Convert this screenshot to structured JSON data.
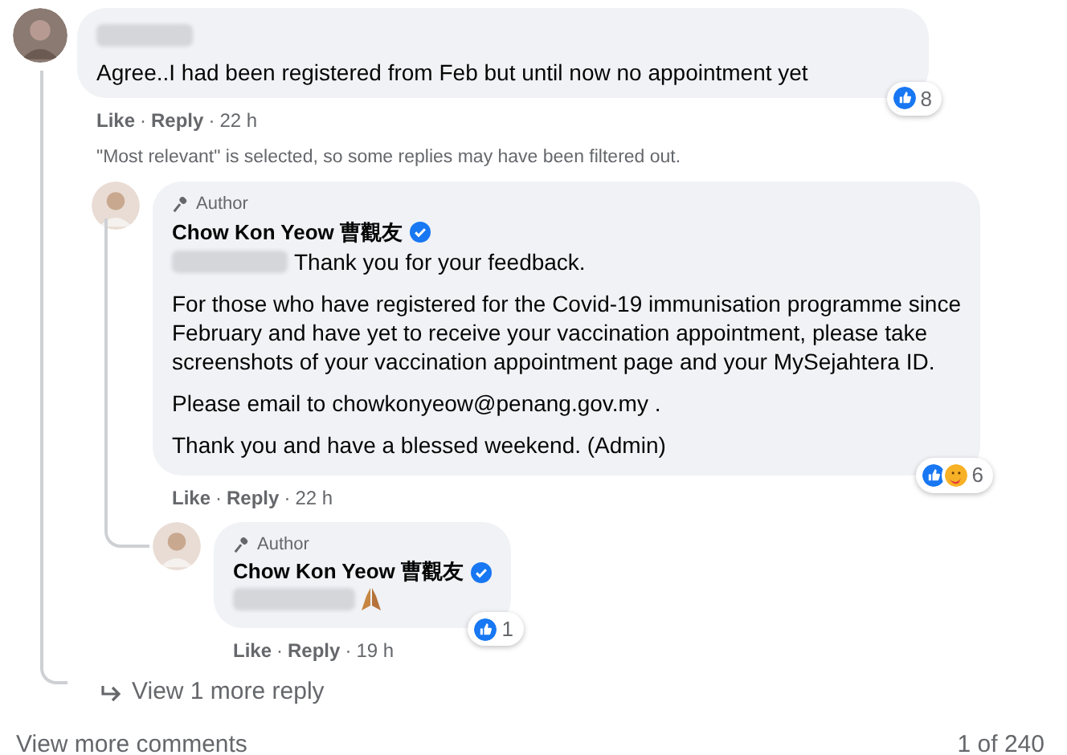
{
  "comment": {
    "body": [
      "Agree..I had been registered from Feb but until now no appointment yet"
    ],
    "reactions": [
      {
        "kind": "like"
      }
    ],
    "reaction_count": "8",
    "actions": [
      "Like",
      "Reply"
    ],
    "separator": "·",
    "time": "22 h"
  },
  "filter_note": "\"Most relevant\" is selected, so some replies may have been filtered out.",
  "replies": [
    {
      "badge": "Author",
      "name": "Chow Kon Yeow 曹觀友",
      "verified": true,
      "greeting": "Thank you for your feedback.",
      "body": [
        "For those who have registered for the Covid-19 immunisation programme since February and have yet to receive your vaccination appointment, please take screenshots of your vaccination appointment page and your MySejahtera ID.",
        "Please email to chowkonyeow@penang.gov.my .",
        "Thank you and have a blessed weekend. (Admin)"
      ],
      "reactions": [
        {
          "kind": "like"
        },
        {
          "kind": "care"
        }
      ],
      "reaction_count": "6",
      "actions": [
        "Like",
        "Reply"
      ],
      "separator": "·",
      "time": "22 h"
    },
    {
      "badge": "Author",
      "name": "Chow Kon Yeow 曹觀友",
      "verified": true,
      "reactions": [
        {
          "kind": "like"
        }
      ],
      "reaction_count": "1",
      "actions": [
        "Like",
        "Reply"
      ],
      "separator": "·",
      "time": "19 h"
    }
  ],
  "more_replies": "View 1 more reply",
  "more_comments": "View more comments",
  "pager": "1 of 240"
}
